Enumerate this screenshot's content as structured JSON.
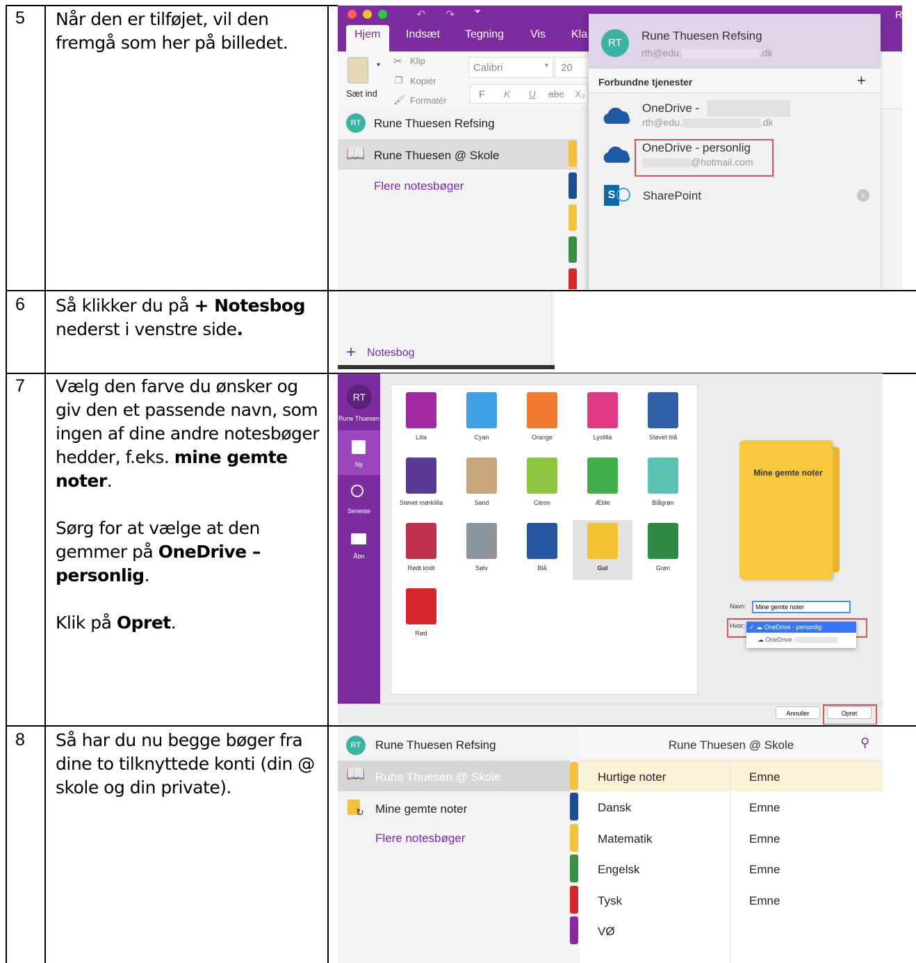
{
  "steps": [
    {
      "num": "5",
      "text_a": "Når den er tilføjet, vil den fremgå som her på billedet."
    },
    {
      "num": "6",
      "text_a": "Så klikker du på ",
      "bold_a": "+ Notesbog",
      "text_b": " nederst i venstre side",
      "bold_b": "."
    },
    {
      "num": "7",
      "p1_a": "Vælg den farve du ønsker og giv den et passende navn, som ingen af dine andre notesbøger hedder, f.eks. ",
      "p1_bold": "mine gemte noter",
      "p1_b": ".",
      "p2_a": "Sørg for at vælge at den gemmer på ",
      "p2_bold": "OneDrive – personlig",
      "p2_b": ".",
      "p3_a": "Klik på ",
      "p3_bold": "Opret",
      "p3_b": "."
    },
    {
      "num": "8",
      "text_a": "Så har du nu begge bøger fra dine to tilknyttede konti (din @ skole og din private)."
    }
  ],
  "s5": {
    "tabs": [
      "Hjem",
      "Indsæt",
      "Tegning",
      "Vis",
      "Kla"
    ],
    "clip": "Klip",
    "copy": "Kopiér",
    "format": "Formatér",
    "paste": "Sæt ind",
    "font": "Calibri",
    "size": "20",
    "fmt": [
      "F",
      "K",
      "U",
      "abc",
      "X₂"
    ],
    "corner_letter": "R",
    "nb_user": "Rune Thuesen Refsing",
    "nb_school": "Rune Thuesen @ Skole",
    "more": "Flere notesbøger",
    "initials": "RT",
    "panel_name": "Rune Thuesen Refsing",
    "panel_mail_a": "rth@edu.",
    "panel_mail_b": ".dk",
    "connected": "Forbundne tjenester",
    "plus": "+",
    "od1": "OneDrive -",
    "od1_mail_a": "rth@edu.",
    "od1_mail_b": ".dk",
    "od2": "OneDrive - personlig",
    "od2_mail": "@hotmail.com",
    "sp": "SharePoint",
    "sp_letter": "S"
  },
  "s6": {
    "plus": "+",
    "label": "Notesbog"
  },
  "s7": {
    "initials": "RT",
    "user": "Rune Thuesen",
    "side": [
      "Ny",
      "Seneste",
      "Åbn"
    ],
    "colors": [
      {
        "name": "Lilla",
        "hex": "#a42aa5"
      },
      {
        "name": "Cyan",
        "hex": "#3ea0e0"
      },
      {
        "name": "Orange",
        "hex": "#ef7a30"
      },
      {
        "name": "Lyslilla",
        "hex": "#e03a86"
      },
      {
        "name": "Støvet blå",
        "hex": "#2f62a8"
      },
      {
        "name": "Støvet mørklilla",
        "hex": "#5c3b98"
      },
      {
        "name": "Sand",
        "hex": "#c9a57b"
      },
      {
        "name": "Citron",
        "hex": "#8cc63f"
      },
      {
        "name": "Æble",
        "hex": "#3fae4b"
      },
      {
        "name": "Blågrøn",
        "hex": "#5cc3b4"
      },
      {
        "name": "Rødt kridt",
        "hex": "#c0304f"
      },
      {
        "name": "Sølv",
        "hex": "#8e969c"
      },
      {
        "name": "Blå",
        "hex": "#2755a0"
      },
      {
        "name": "Gul",
        "hex": "#f1c233"
      },
      {
        "name": "Grøn",
        "hex": "#2f8b43"
      },
      {
        "name": "Rød",
        "hex": "#d8272d"
      }
    ],
    "preview": "Mine gemte noter",
    "name_label": "Navn:",
    "name_value": "Mine gemte noter",
    "where_label": "Hvor:",
    "opt1": "OneDrive - personlig",
    "opt2": "OneDrive -",
    "cancel": "Annuller",
    "create": "Opret"
  },
  "s8": {
    "initials": "RT",
    "user": "Rune Thuesen Refsing",
    "school": "Rune Thuesen @ Skole",
    "saved": "Mine gemte noter",
    "more": "Flere notesbøger",
    "header": "Rune Thuesen @ Skole",
    "sections": [
      "Hurtige noter",
      "Dansk",
      "Matematik",
      "Engelsk",
      "Tysk",
      "VØ"
    ],
    "section_colors": [
      "#f3c13a",
      "#1e4f8f",
      "#f3c13a",
      "#3a8f45",
      "#d8272d",
      "#8a2aa0"
    ],
    "emne": [
      "Emne",
      "Emne",
      "Emne",
      "Emne",
      "Emne"
    ]
  }
}
